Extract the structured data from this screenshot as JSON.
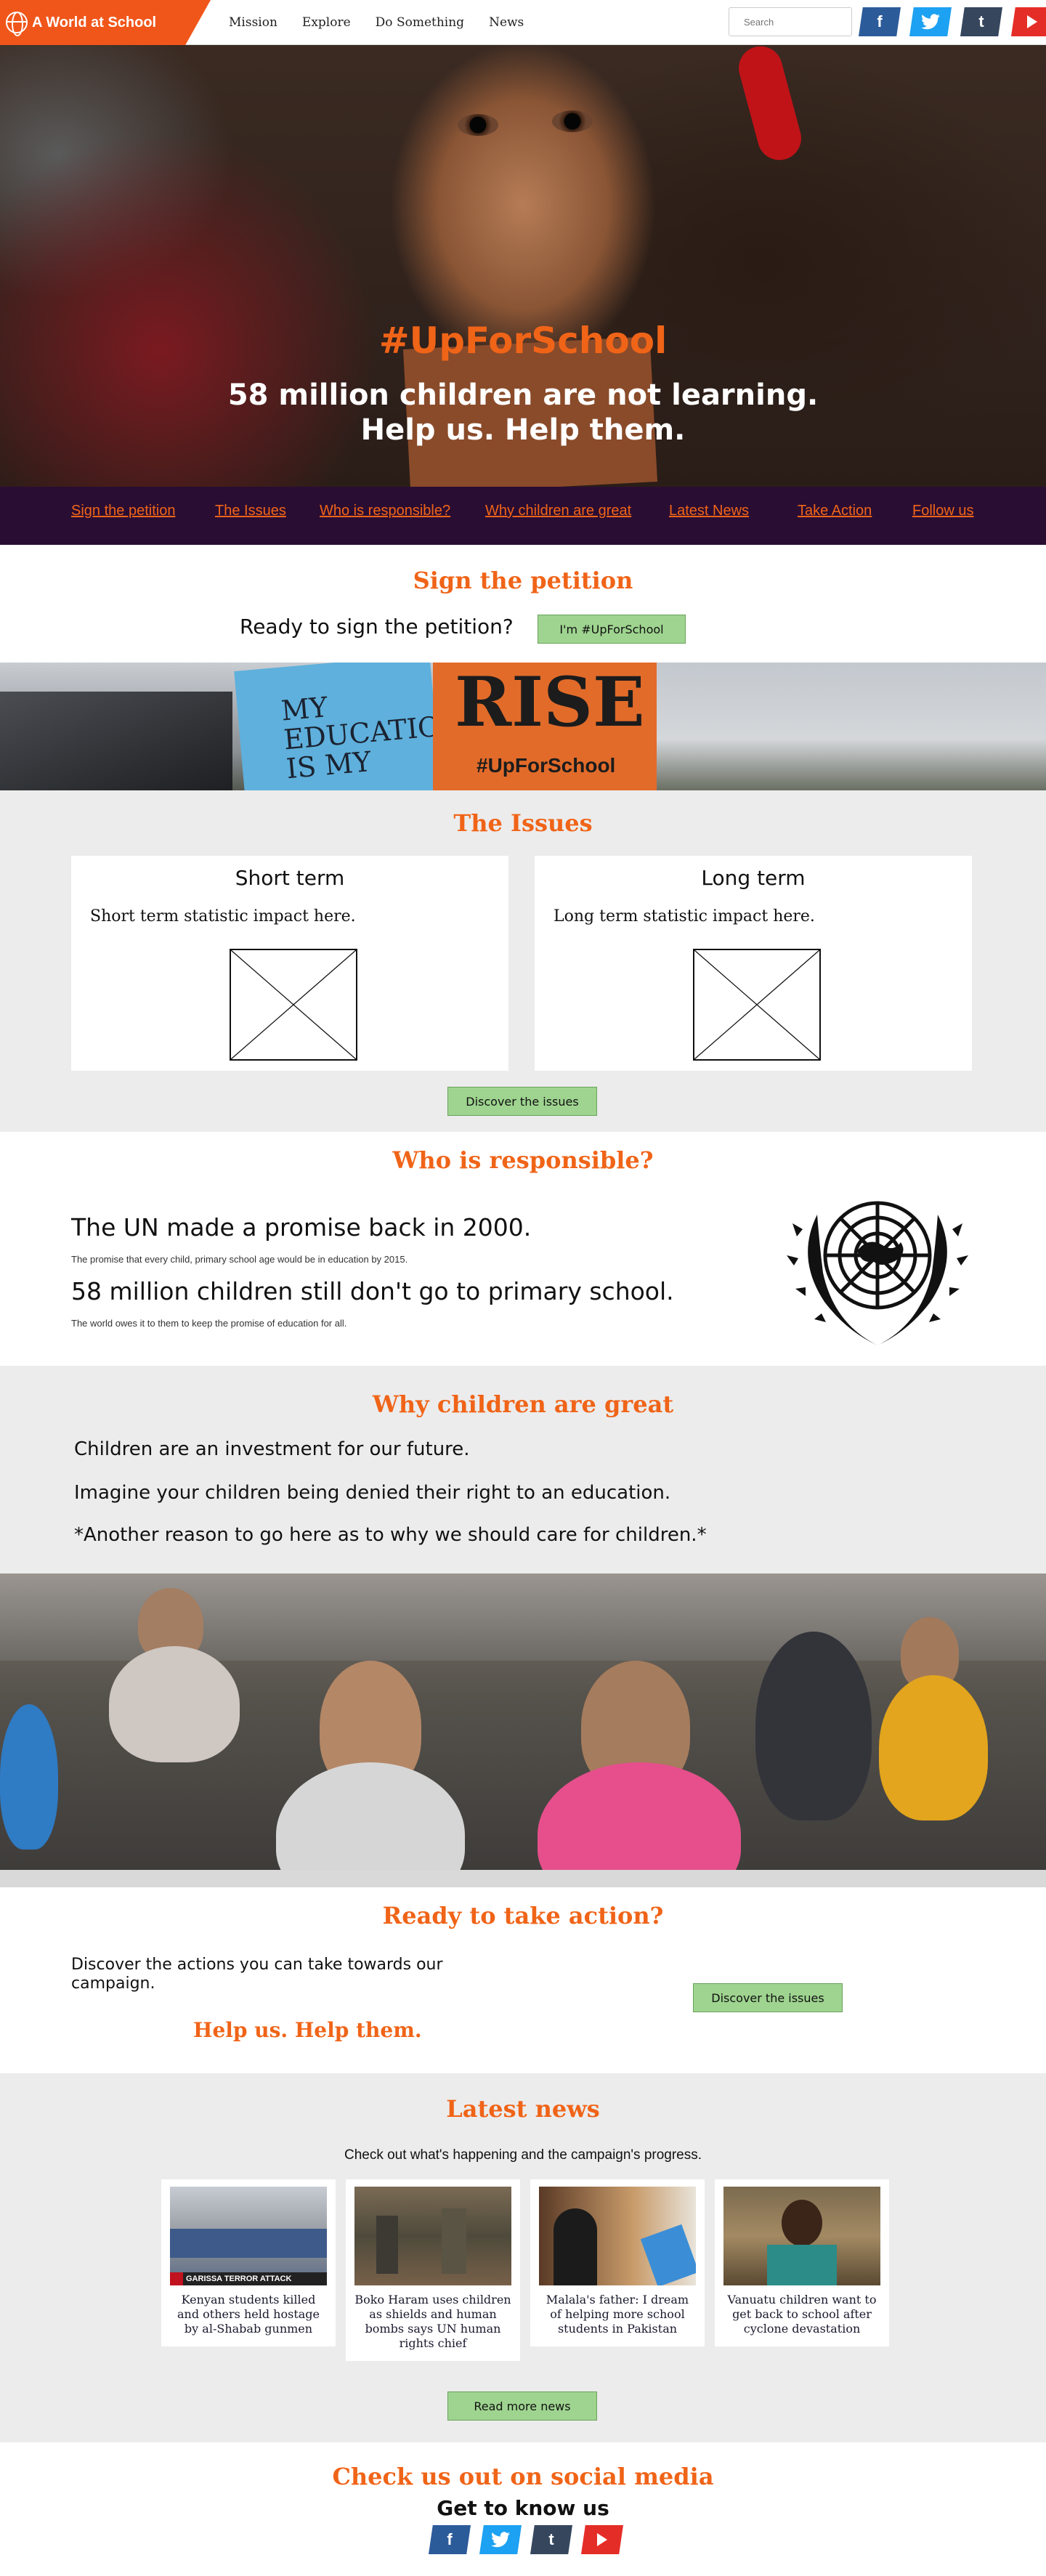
{
  "header": {
    "logo_text": "A World at School",
    "nav": [
      "Mission",
      "Explore",
      "Do Something",
      "News"
    ],
    "search_placeholder": "Search",
    "social": [
      {
        "name": "facebook",
        "glyph": "f"
      },
      {
        "name": "twitter",
        "glyph": "t"
      },
      {
        "name": "tumblr",
        "glyph": "t"
      },
      {
        "name": "youtube",
        "glyph": ""
      }
    ]
  },
  "hero": {
    "hashtag": "#UpForSchool",
    "line1": "58 million children are not learning.",
    "line2": "Help us. Help them."
  },
  "subnav": [
    "Sign the petition",
    "The Issues",
    "Who is responsible?",
    "Why children are great",
    "Latest News",
    "Take Action",
    "Follow us"
  ],
  "petition": {
    "title": "Sign the petition",
    "prompt": "Ready to sign the petition?",
    "button": "I'm #UpForSchool"
  },
  "banner": {
    "sign_left": "MY EDUCATION IS MY",
    "sign_right_big": "RISE",
    "sign_right_tag": "#UpForSchool"
  },
  "issues": {
    "title": "The Issues",
    "cards": [
      {
        "heading": "Short term",
        "text": "Short term statistic impact here."
      },
      {
        "heading": "Long term",
        "text": "Long term statistic impact here."
      }
    ],
    "button": "Discover the issues"
  },
  "responsible": {
    "title": "Who is responsible?",
    "headline1": "The UN made a promise back in 2000.",
    "sub1": "The promise that every child, primary school age would be in education by 2015.",
    "headline2": "58 million children still don't go to primary school.",
    "sub2": "The world owes it to them to keep the promise of education for all."
  },
  "why": {
    "title": "Why children are great",
    "lines": [
      "Children are an investment for our future.",
      "Imagine your children being denied their right to an education.",
      "*Another reason to go here as to why we should care for children.*"
    ]
  },
  "action": {
    "title": "Ready to take action?",
    "text": "Discover the actions you can take towards our campaign.",
    "tagline": "Help us. Help them.",
    "button": "Discover the issues"
  },
  "news": {
    "title": "Latest news",
    "intro": "Check out what's happening and the campaign's progress.",
    "items": [
      {
        "caption": "Kenyan students killed and others held hostage by al-Shabab gunmen",
        "img_label": "GARISSA TERROR ATTACK"
      },
      {
        "caption": "Boko Haram uses children as shields and human bombs says UN human rights chief"
      },
      {
        "caption": "Malala's father: I dream of helping more school students in Pakistan"
      },
      {
        "caption": "Vanuatu children want to get back to school after cyclone devastation"
      }
    ],
    "button": "Read more news"
  },
  "footer": {
    "title": "Check us out on social media",
    "subtitle": "Get to know us"
  },
  "colors": {
    "accent": "#f06418",
    "purple": "#2a0d33",
    "green": "#9ed48f"
  }
}
